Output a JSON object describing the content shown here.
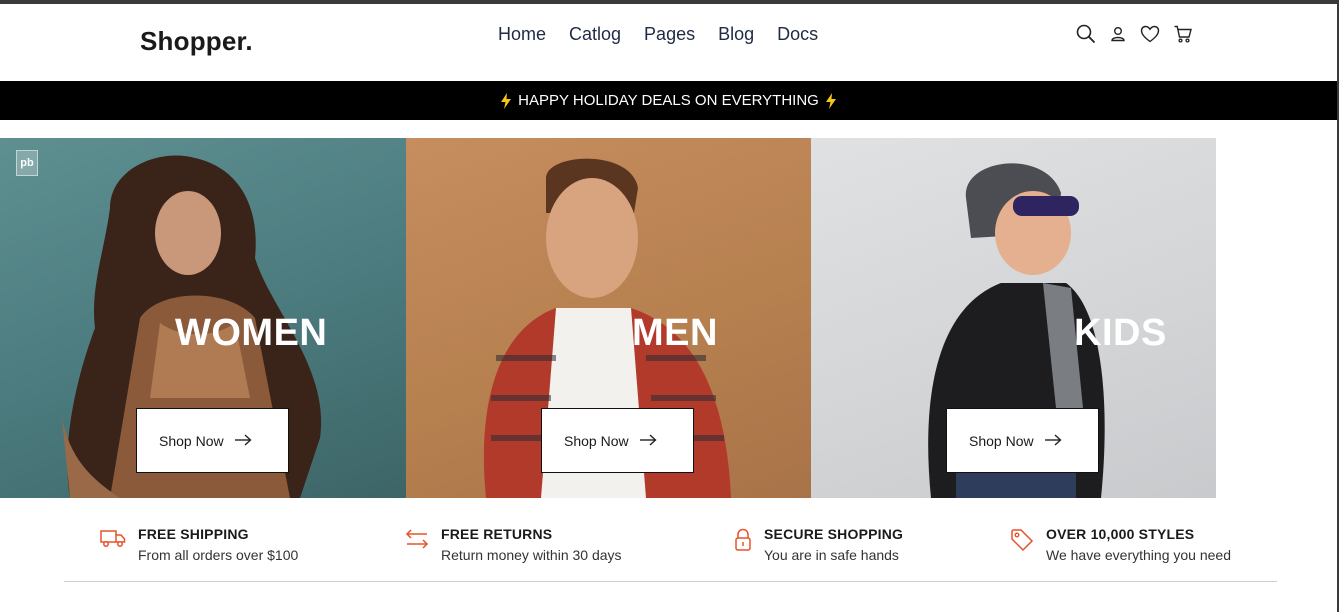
{
  "header": {
    "logo": "Shopper.",
    "nav": [
      "Home",
      "Catlog",
      "Pages",
      "Blog",
      "Docs"
    ],
    "icons": [
      "search-icon",
      "user-icon",
      "heart-icon",
      "cart-icon"
    ]
  },
  "promo": {
    "text": "HAPPY HOLIDAY DEALS ON EVERYTHING",
    "accent": "#f5c518"
  },
  "tiles": [
    {
      "title": "WOMEN",
      "button": "Shop Now",
      "bg": "#4f8385"
    },
    {
      "title": "MEN",
      "button": "Shop Now",
      "bg": "#b98251"
    },
    {
      "title": "KIDS",
      "button": "Shop Now",
      "bg": "#d4d6d8"
    }
  ],
  "badge": "pb",
  "features": [
    {
      "icon": "truck-icon",
      "title": "FREE SHIPPING",
      "subtitle": "From all orders over $100"
    },
    {
      "icon": "exchange-icon",
      "title": "FREE RETURNS",
      "subtitle": "Return money within 30 days"
    },
    {
      "icon": "lock-icon",
      "title": "SECURE SHOPPING",
      "subtitle": "You are in safe hands"
    },
    {
      "icon": "tag-icon",
      "title": "OVER 10,000 STYLES",
      "subtitle": "We have everything you need"
    }
  ],
  "colors": {
    "accent": "#e8502a",
    "promo_bg": "#000000",
    "text": "#1a1a1a"
  }
}
